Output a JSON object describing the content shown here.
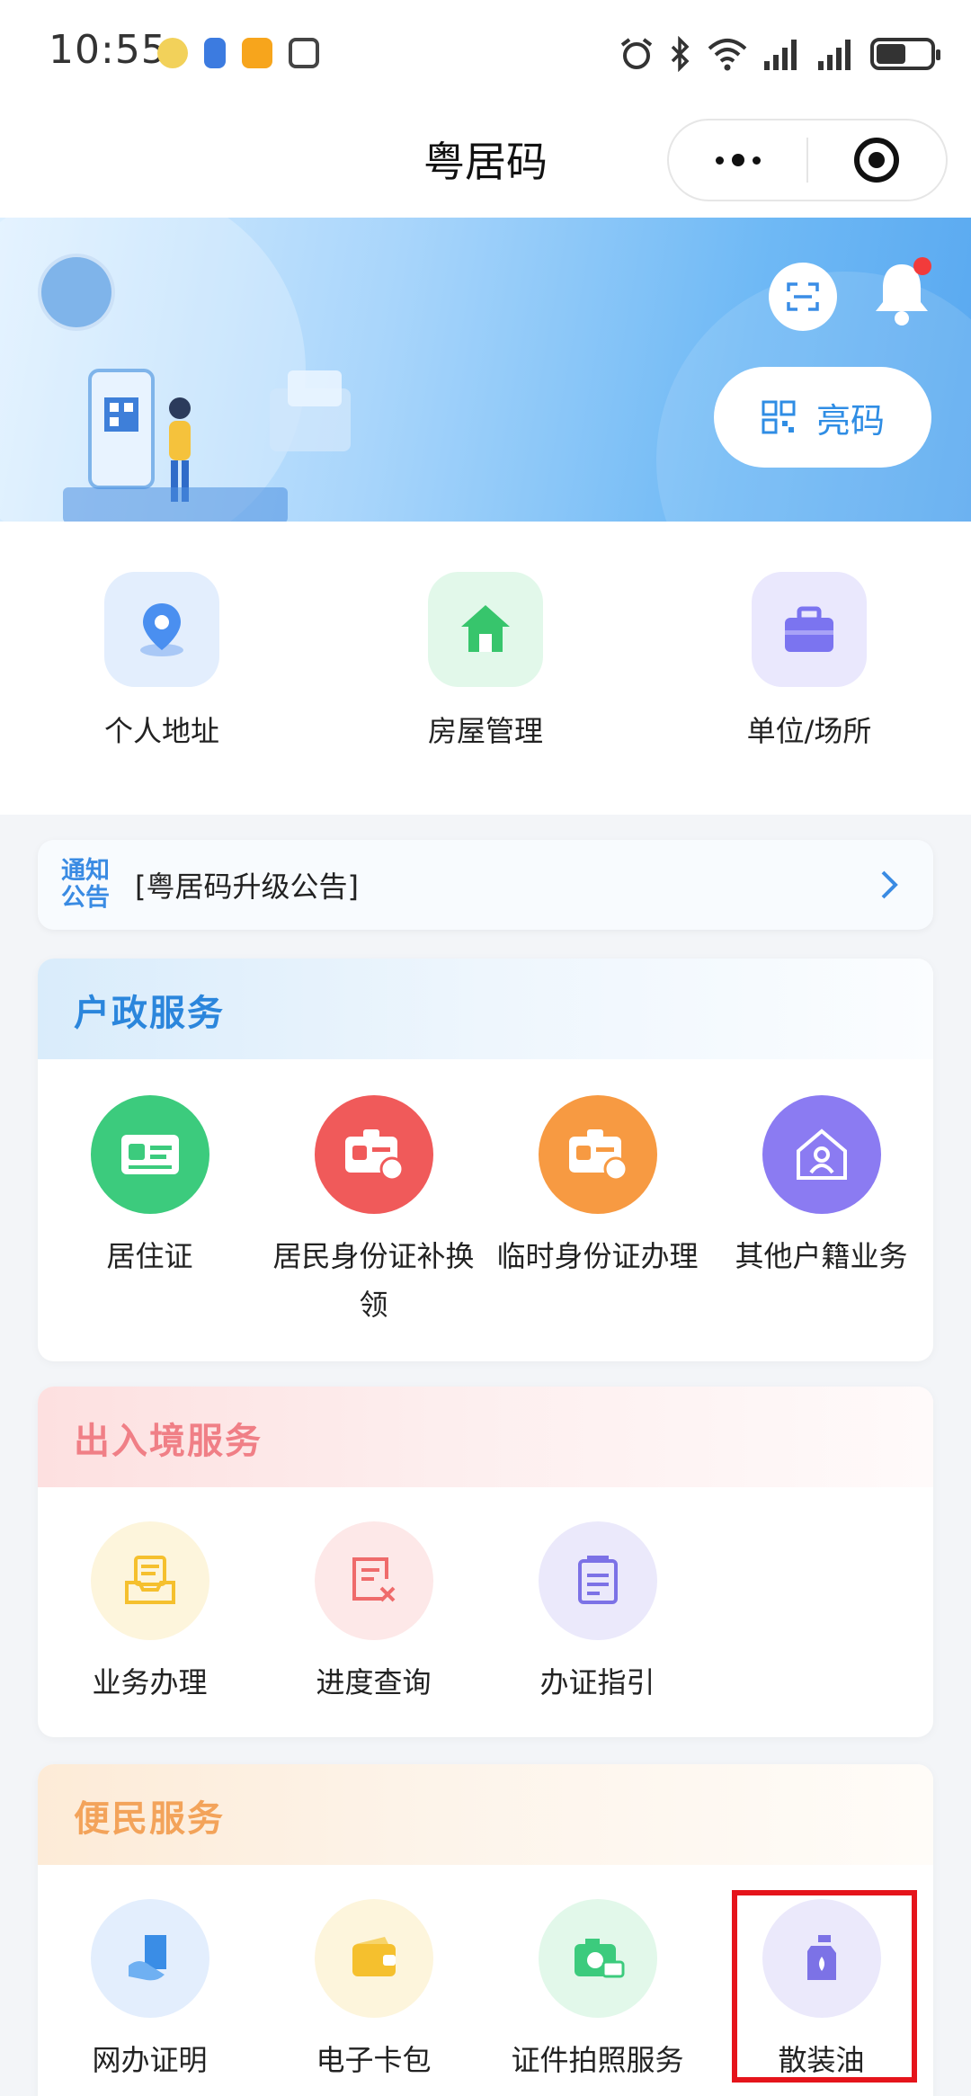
{
  "status_bar": {
    "time": "10:55",
    "left_icons": [
      "cartoon-icon",
      "app-badge-icon",
      "yellow-app-icon",
      "nfc-icon"
    ],
    "right_icons": [
      "alarm-icon",
      "bluetooth-icon",
      "wifi-icon",
      "signal-icon",
      "signal-icon",
      "battery-icon"
    ],
    "battery_level": 0.55
  },
  "nav": {
    "title": "粤居码",
    "more_icon": "more-icon",
    "close_icon": "target-icon"
  },
  "banner": {
    "scan_icon": "scan-icon",
    "bell_icon": "bell-icon",
    "show_code_label": "亮码",
    "show_code_icon": "qr-code-icon"
  },
  "quick_entries": [
    {
      "label": "个人地址",
      "icon": "location-icon",
      "color": "#4a8ff0"
    },
    {
      "label": "房屋管理",
      "icon": "house-icon",
      "color": "#37c56c"
    },
    {
      "label": "单位/场所",
      "icon": "briefcase-icon",
      "color": "#7b74f0"
    }
  ],
  "notice": {
    "tag": "通知公告",
    "text": "[粤居码升级公告]"
  },
  "sections": {
    "household": {
      "title": "户政服务",
      "items": [
        {
          "label": "居住证",
          "icon": "id-card-icon",
          "color": "#3ccb7d"
        },
        {
          "label": "居民身份证补换领",
          "icon": "id-card-reissue-icon",
          "color": "#f05a5a"
        },
        {
          "label": "临时身份证办理",
          "icon": "temp-id-card-icon",
          "color": "#f79a42"
        },
        {
          "label": "其他户籍业务",
          "icon": "home-person-icon",
          "color": "#8b7bf2"
        }
      ]
    },
    "immigration": {
      "title": "出入境服务",
      "items": [
        {
          "label": "业务办理",
          "icon": "inbox-document-icon",
          "color": "#f5c02e"
        },
        {
          "label": "进度查询",
          "icon": "document-x-icon",
          "color": "#ef6b6b"
        },
        {
          "label": "办证指引",
          "icon": "guide-document-icon",
          "color": "#7c72e6"
        }
      ]
    },
    "convenience": {
      "title": "便民服务",
      "items": [
        {
          "label": "网办证明",
          "icon": "certificate-hand-icon",
          "color": "#3a8de6"
        },
        {
          "label": "电子卡包",
          "icon": "wallet-icon",
          "color": "#f5c02e"
        },
        {
          "label": "证件拍照服务",
          "icon": "camera-id-icon",
          "color": "#3ccb7d"
        },
        {
          "label": "散装油",
          "icon": "oil-bottle-icon",
          "color": "#7c72e6"
        }
      ]
    }
  }
}
